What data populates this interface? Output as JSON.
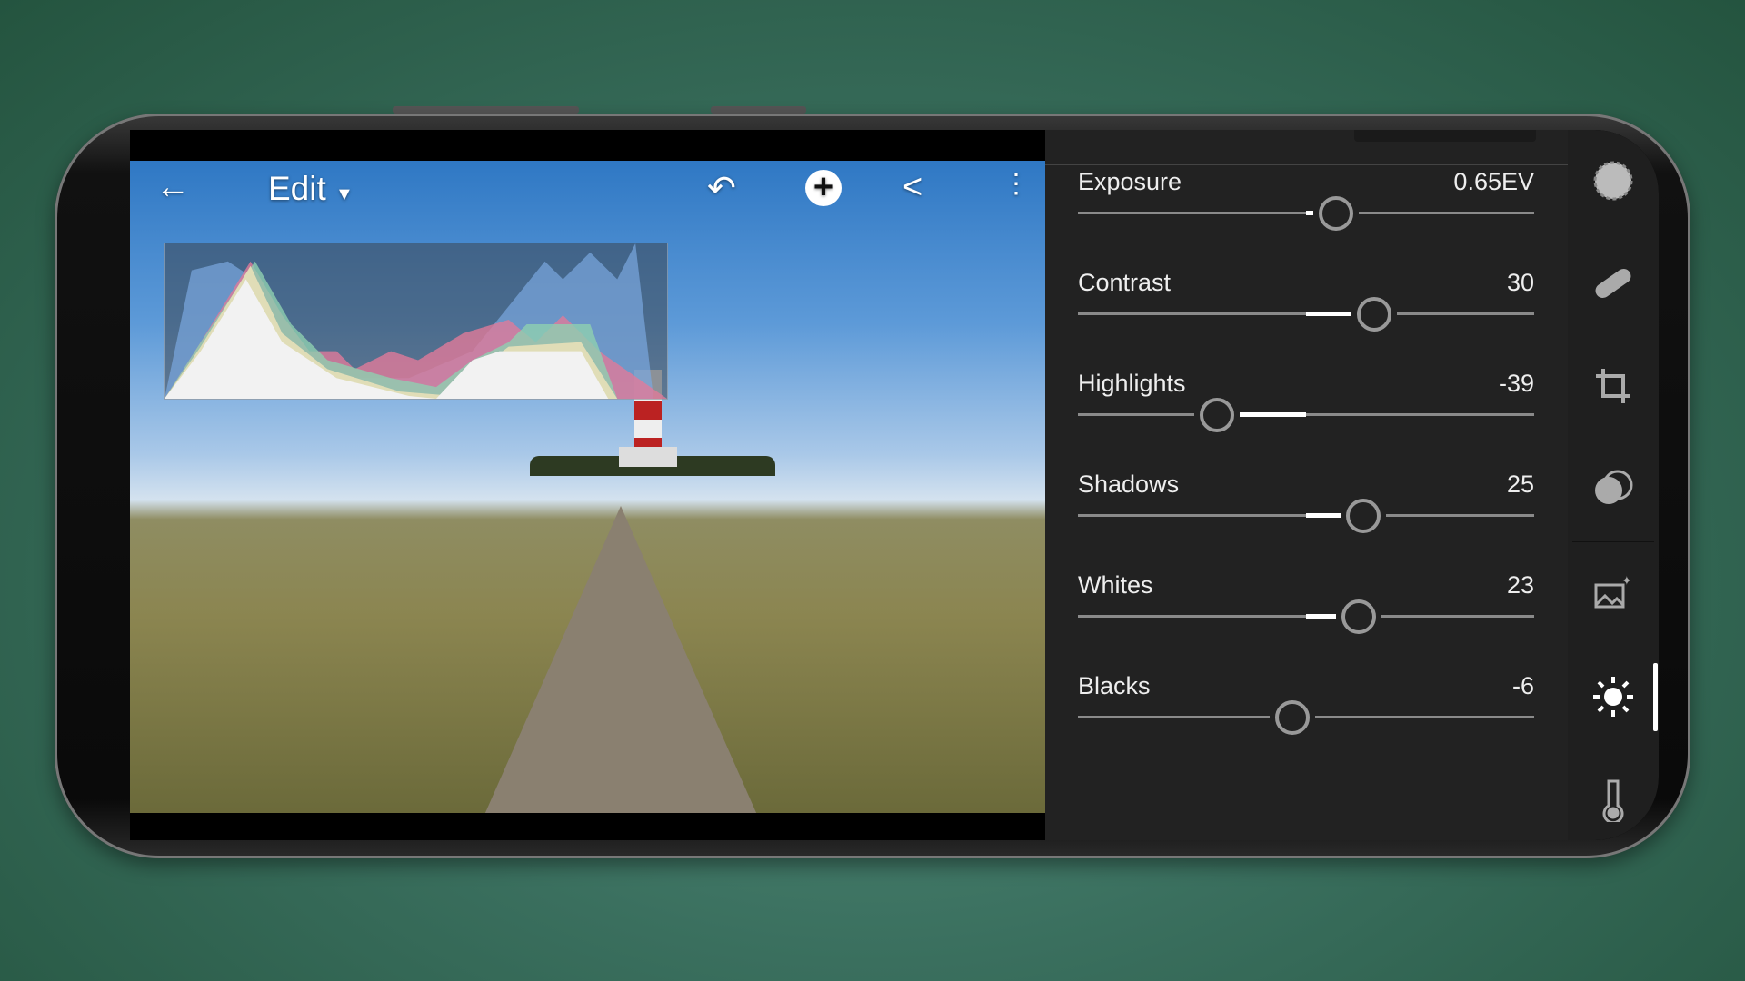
{
  "header": {
    "title": "Edit",
    "back_icon": "arrow-left-icon",
    "undo_icon": "undo-icon",
    "add_icon": "plus-circle-icon",
    "share_icon": "share-icon",
    "more_icon": "more-vertical-icon"
  },
  "light_panel": {
    "sliders": [
      {
        "label": "Exposure",
        "value": "0.65EV",
        "numeric": 0.65,
        "min": -5,
        "max": 5
      },
      {
        "label": "Contrast",
        "value": "30",
        "numeric": 30,
        "min": -100,
        "max": 100
      },
      {
        "label": "Highlights",
        "value": "-39",
        "numeric": -39,
        "min": -100,
        "max": 100
      },
      {
        "label": "Shadows",
        "value": "25",
        "numeric": 25,
        "min": -100,
        "max": 100
      },
      {
        "label": "Whites",
        "value": "23",
        "numeric": 23,
        "min": -100,
        "max": 100
      },
      {
        "label": "Blacks",
        "value": "-6",
        "numeric": -6,
        "min": -100,
        "max": 100
      }
    ]
  },
  "tools": [
    "selective-icon",
    "healing-icon",
    "crop-icon",
    "masking-icon",
    "presets-icon",
    "light-icon",
    "color-temperature-icon"
  ],
  "active_tool": "light-icon",
  "colors": {
    "panel": "#222222",
    "track": "#8a8a8a",
    "accent": "#ffffff"
  }
}
